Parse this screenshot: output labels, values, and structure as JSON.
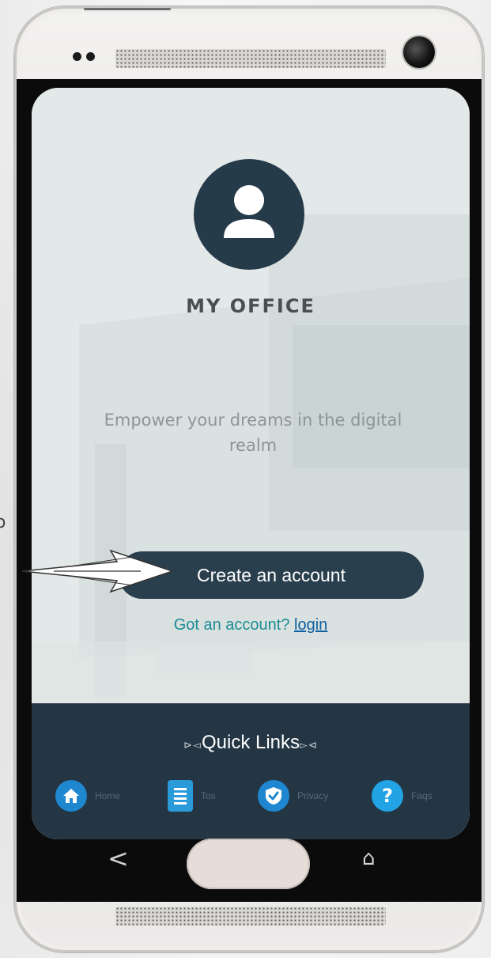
{
  "background": {
    "edge_text": "o"
  },
  "app": {
    "title": "MY OFFICE",
    "tagline": "Empower your dreams in the digital realm",
    "create_account_label": "Create an account",
    "login_prompt": "Got an account?",
    "login_link": "login"
  },
  "quick_links": {
    "title": "Quick Links",
    "items": [
      {
        "label": "Home",
        "icon": "home-icon"
      },
      {
        "label": "Tos",
        "icon": "document-icon"
      },
      {
        "label": "Privacy",
        "icon": "shield-check-icon"
      },
      {
        "label": "Faqs",
        "icon": "question-icon"
      }
    ],
    "faq_glyph": "?"
  },
  "nav": {
    "back_glyph": "<",
    "home_glyph": "⌂"
  },
  "colors": {
    "primary": "#2a3f4e",
    "accent_blue": "#1f87cf",
    "link_teal": "#1c8c95",
    "quick_links_bg": "#243644"
  }
}
